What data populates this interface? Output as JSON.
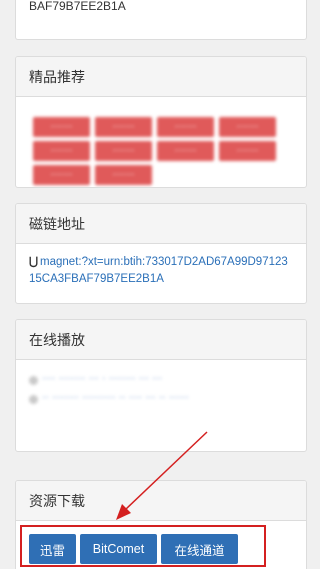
{
  "top_panel": {
    "hash_tail": "BAF79B7EE2B1A"
  },
  "recommend": {
    "title": "精品推荐",
    "items": [
      "·······",
      "·······",
      "·······",
      "·······",
      "·······",
      "·······",
      "·······",
      "·······",
      "·······",
      "·······"
    ]
  },
  "magnet": {
    "title": "磁链地址",
    "icon": "magnet-icon",
    "link": "magnet:?xt=urn:btih:733017D2AD67A99D9712315CA3FBAF79B7EE2B1A"
  },
  "online_play": {
    "title": "在线播放",
    "lines": [
      "···· ········ ··· · ········ ··· ···",
      "·· ········ ·········· ·· ···· ··· ·· ······"
    ]
  },
  "download": {
    "title": "资源下载",
    "buttons": [
      "迅雷",
      "BitComet",
      "在线通道"
    ]
  },
  "colors": {
    "accent": "#2f6fb5",
    "annotation": "#d42020",
    "recommend": "#e05a5a"
  }
}
